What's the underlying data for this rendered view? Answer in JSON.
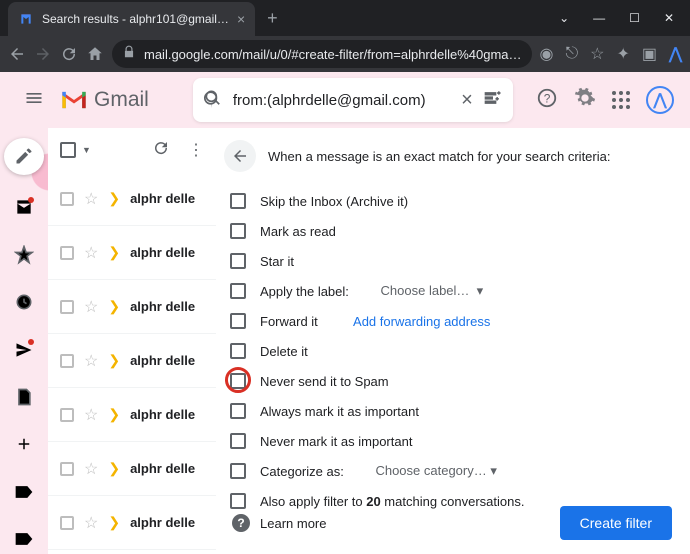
{
  "browser": {
    "tab_title": "Search results - alphr101@gmail…",
    "url": "mail.google.com/mail/u/0/#create-filter/from=alphrdelle%40gma…"
  },
  "gmail": {
    "brand": "Gmail",
    "search_query": "from:(alphrdelle@gmail.com)"
  },
  "mail_list": {
    "sender": "alphr delle"
  },
  "filter": {
    "heading": "When a message is an exact match for your search criteria:",
    "options": {
      "skip_inbox": "Skip the Inbox (Archive it)",
      "mark_read": "Mark as read",
      "star_it": "Star it",
      "apply_label": "Apply the label:",
      "choose_label": "Choose label…",
      "forward_it": "Forward it",
      "add_forwarding": "Add forwarding address",
      "delete_it": "Delete it",
      "never_spam": "Never send it to Spam",
      "always_important": "Always mark it as important",
      "never_important": "Never mark it as important",
      "categorize_as": "Categorize as:",
      "choose_category": "Choose category…",
      "also_apply_pre": "Also apply filter to ",
      "also_apply_count": "20",
      "also_apply_post": " matching conversations."
    },
    "learn_more": "Learn more",
    "create_button": "Create filter"
  }
}
